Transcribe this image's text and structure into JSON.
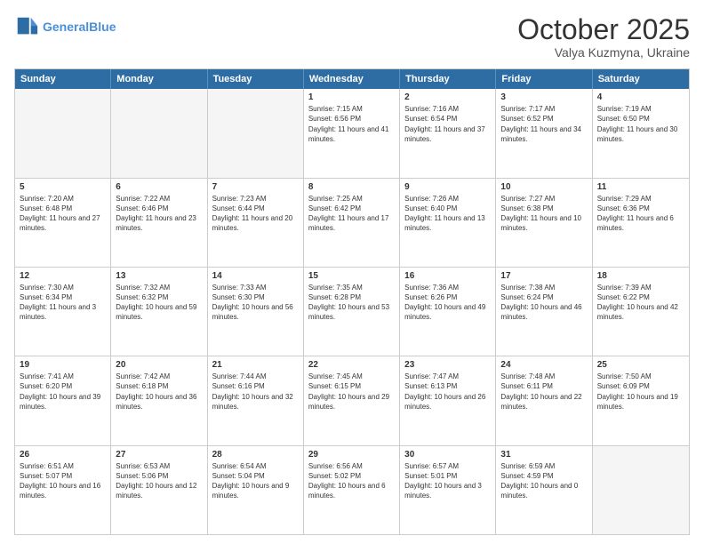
{
  "header": {
    "logo_line1": "General",
    "logo_line2": "Blue",
    "month": "October 2025",
    "location": "Valya Kuzmyna, Ukraine"
  },
  "days_of_week": [
    "Sunday",
    "Monday",
    "Tuesday",
    "Wednesday",
    "Thursday",
    "Friday",
    "Saturday"
  ],
  "weeks": [
    [
      {
        "day": "",
        "text": ""
      },
      {
        "day": "",
        "text": ""
      },
      {
        "day": "",
        "text": ""
      },
      {
        "day": "1",
        "text": "Sunrise: 7:15 AM\nSunset: 6:56 PM\nDaylight: 11 hours and 41 minutes."
      },
      {
        "day": "2",
        "text": "Sunrise: 7:16 AM\nSunset: 6:54 PM\nDaylight: 11 hours and 37 minutes."
      },
      {
        "day": "3",
        "text": "Sunrise: 7:17 AM\nSunset: 6:52 PM\nDaylight: 11 hours and 34 minutes."
      },
      {
        "day": "4",
        "text": "Sunrise: 7:19 AM\nSunset: 6:50 PM\nDaylight: 11 hours and 30 minutes."
      }
    ],
    [
      {
        "day": "5",
        "text": "Sunrise: 7:20 AM\nSunset: 6:48 PM\nDaylight: 11 hours and 27 minutes."
      },
      {
        "day": "6",
        "text": "Sunrise: 7:22 AM\nSunset: 6:46 PM\nDaylight: 11 hours and 23 minutes."
      },
      {
        "day": "7",
        "text": "Sunrise: 7:23 AM\nSunset: 6:44 PM\nDaylight: 11 hours and 20 minutes."
      },
      {
        "day": "8",
        "text": "Sunrise: 7:25 AM\nSunset: 6:42 PM\nDaylight: 11 hours and 17 minutes."
      },
      {
        "day": "9",
        "text": "Sunrise: 7:26 AM\nSunset: 6:40 PM\nDaylight: 11 hours and 13 minutes."
      },
      {
        "day": "10",
        "text": "Sunrise: 7:27 AM\nSunset: 6:38 PM\nDaylight: 11 hours and 10 minutes."
      },
      {
        "day": "11",
        "text": "Sunrise: 7:29 AM\nSunset: 6:36 PM\nDaylight: 11 hours and 6 minutes."
      }
    ],
    [
      {
        "day": "12",
        "text": "Sunrise: 7:30 AM\nSunset: 6:34 PM\nDaylight: 11 hours and 3 minutes."
      },
      {
        "day": "13",
        "text": "Sunrise: 7:32 AM\nSunset: 6:32 PM\nDaylight: 10 hours and 59 minutes."
      },
      {
        "day": "14",
        "text": "Sunrise: 7:33 AM\nSunset: 6:30 PM\nDaylight: 10 hours and 56 minutes."
      },
      {
        "day": "15",
        "text": "Sunrise: 7:35 AM\nSunset: 6:28 PM\nDaylight: 10 hours and 53 minutes."
      },
      {
        "day": "16",
        "text": "Sunrise: 7:36 AM\nSunset: 6:26 PM\nDaylight: 10 hours and 49 minutes."
      },
      {
        "day": "17",
        "text": "Sunrise: 7:38 AM\nSunset: 6:24 PM\nDaylight: 10 hours and 46 minutes."
      },
      {
        "day": "18",
        "text": "Sunrise: 7:39 AM\nSunset: 6:22 PM\nDaylight: 10 hours and 42 minutes."
      }
    ],
    [
      {
        "day": "19",
        "text": "Sunrise: 7:41 AM\nSunset: 6:20 PM\nDaylight: 10 hours and 39 minutes."
      },
      {
        "day": "20",
        "text": "Sunrise: 7:42 AM\nSunset: 6:18 PM\nDaylight: 10 hours and 36 minutes."
      },
      {
        "day": "21",
        "text": "Sunrise: 7:44 AM\nSunset: 6:16 PM\nDaylight: 10 hours and 32 minutes."
      },
      {
        "day": "22",
        "text": "Sunrise: 7:45 AM\nSunset: 6:15 PM\nDaylight: 10 hours and 29 minutes."
      },
      {
        "day": "23",
        "text": "Sunrise: 7:47 AM\nSunset: 6:13 PM\nDaylight: 10 hours and 26 minutes."
      },
      {
        "day": "24",
        "text": "Sunrise: 7:48 AM\nSunset: 6:11 PM\nDaylight: 10 hours and 22 minutes."
      },
      {
        "day": "25",
        "text": "Sunrise: 7:50 AM\nSunset: 6:09 PM\nDaylight: 10 hours and 19 minutes."
      }
    ],
    [
      {
        "day": "26",
        "text": "Sunrise: 6:51 AM\nSunset: 5:07 PM\nDaylight: 10 hours and 16 minutes."
      },
      {
        "day": "27",
        "text": "Sunrise: 6:53 AM\nSunset: 5:06 PM\nDaylight: 10 hours and 12 minutes."
      },
      {
        "day": "28",
        "text": "Sunrise: 6:54 AM\nSunset: 5:04 PM\nDaylight: 10 hours and 9 minutes."
      },
      {
        "day": "29",
        "text": "Sunrise: 6:56 AM\nSunset: 5:02 PM\nDaylight: 10 hours and 6 minutes."
      },
      {
        "day": "30",
        "text": "Sunrise: 6:57 AM\nSunset: 5:01 PM\nDaylight: 10 hours and 3 minutes."
      },
      {
        "day": "31",
        "text": "Sunrise: 6:59 AM\nSunset: 4:59 PM\nDaylight: 10 hours and 0 minutes."
      },
      {
        "day": "",
        "text": ""
      }
    ]
  ]
}
